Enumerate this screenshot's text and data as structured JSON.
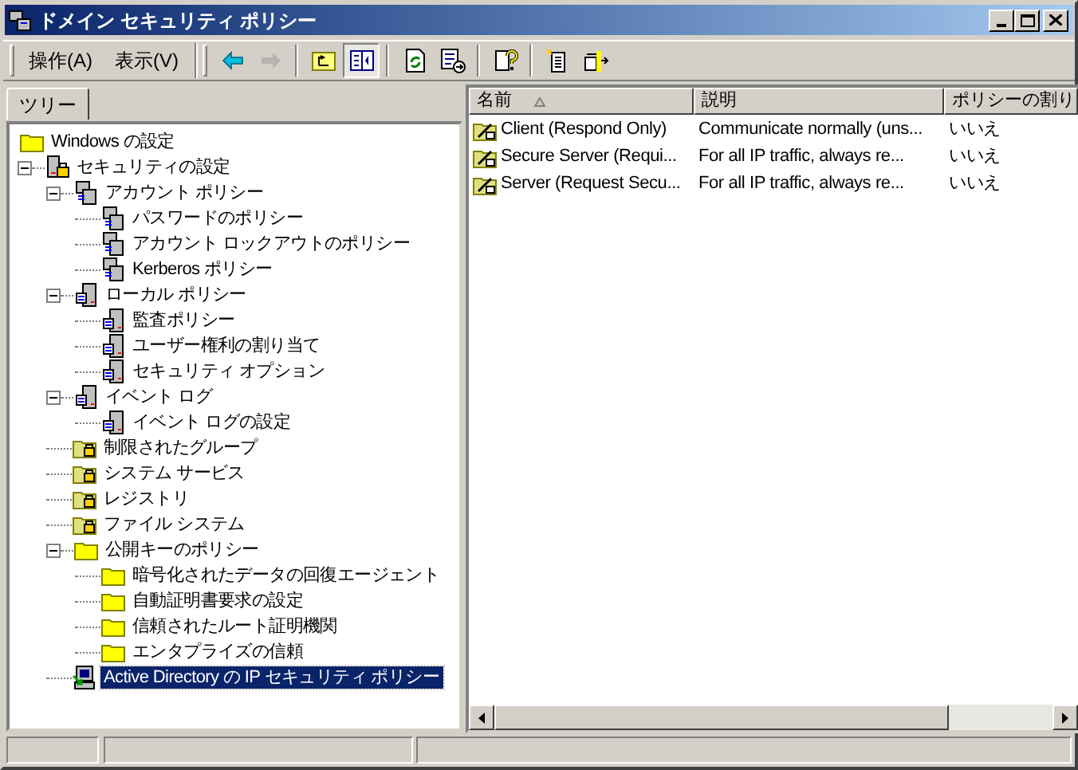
{
  "window": {
    "title": "ドメイン セキュリティ ポリシー"
  },
  "menu": [
    "操作(A)",
    "表示(V)"
  ],
  "toolbar": [
    {
      "kind": "back",
      "disabled": false,
      "pressed": false
    },
    {
      "kind": "forward",
      "disabled": true,
      "pressed": false
    },
    {
      "kind": "sep"
    },
    {
      "kind": "up",
      "disabled": false,
      "pressed": false
    },
    {
      "kind": "tree",
      "disabled": false,
      "pressed": true
    },
    {
      "kind": "sep"
    },
    {
      "kind": "refresh",
      "disabled": false,
      "pressed": false
    },
    {
      "kind": "export",
      "disabled": false,
      "pressed": false
    },
    {
      "kind": "sep"
    },
    {
      "kind": "help",
      "disabled": false,
      "pressed": false
    },
    {
      "kind": "sep"
    },
    {
      "kind": "new",
      "disabled": false,
      "pressed": false
    },
    {
      "kind": "assign",
      "disabled": false,
      "pressed": false
    }
  ],
  "tree_tab": "ツリー",
  "tree": [
    {
      "label": "Windows の設定",
      "kind": "folder",
      "selected": false,
      "children": [
        {
          "label": "セキュリティの設定",
          "kind": "lockserver",
          "expanded": true,
          "selected": false,
          "children": [
            {
              "label": "アカウント ポリシー",
              "kind": "servers",
              "expanded": true,
              "selected": false,
              "children": [
                {
                  "label": "パスワードのポリシー",
                  "kind": "servers",
                  "selected": false
                },
                {
                  "label": "アカウント ロックアウトのポリシー",
                  "kind": "servers",
                  "selected": false
                },
                {
                  "label": "Kerberos ポリシー",
                  "kind": "servers",
                  "selected": false
                }
              ]
            },
            {
              "label": "ローカル ポリシー",
              "kind": "server",
              "expanded": true,
              "selected": false,
              "children": [
                {
                  "label": "監査ポリシー",
                  "kind": "server",
                  "selected": false
                },
                {
                  "label": "ユーザー権利の割り当て",
                  "kind": "server",
                  "selected": false
                },
                {
                  "label": "セキュリティ オプション",
                  "kind": "server",
                  "selected": false
                }
              ]
            },
            {
              "label": "イベント ログ",
              "kind": "server",
              "expanded": true,
              "selected": false,
              "children": [
                {
                  "label": "イベント ログの設定",
                  "kind": "server",
                  "selected": false
                }
              ]
            },
            {
              "label": "制限されたグループ",
              "kind": "lockfolder",
              "selected": false
            },
            {
              "label": "システム サービス",
              "kind": "lockfolder",
              "selected": false
            },
            {
              "label": "レジストリ",
              "kind": "lockfolder",
              "selected": false
            },
            {
              "label": "ファイル システム",
              "kind": "lockfolder",
              "selected": false
            },
            {
              "label": "公開キーのポリシー",
              "kind": "folder",
              "expanded": true,
              "selected": false,
              "children": [
                {
                  "label": "暗号化されたデータの回復エージェント",
                  "kind": "folder",
                  "selected": false
                },
                {
                  "label": "自動証明書要求の設定",
                  "kind": "folder",
                  "selected": false
                },
                {
                  "label": "信頼されたルート証明機関",
                  "kind": "folder",
                  "selected": false
                },
                {
                  "label": "エンタプライズの信頼",
                  "kind": "folder",
                  "selected": false
                }
              ]
            },
            {
              "label": "Active Directory の IP セキュリティ ポリシー",
              "kind": "ipsec",
              "selected": true
            }
          ]
        }
      ]
    }
  ],
  "list": {
    "columns": [
      {
        "label": "名前",
        "sorted": true
      },
      {
        "label": "説明",
        "sorted": false
      },
      {
        "label": "ポリシーの割り",
        "sorted": false
      }
    ],
    "rows": [
      {
        "name": "Client (Respond Only)",
        "description": "Communicate normally (uns...",
        "assigned": "いいえ"
      },
      {
        "name": "Secure Server (Requi...",
        "description": "For all IP traffic, always re...",
        "assigned": "いいえ"
      },
      {
        "name": "Server (Request Secu...",
        "description": "For all IP traffic, always re...",
        "assigned": "いいえ"
      }
    ]
  }
}
